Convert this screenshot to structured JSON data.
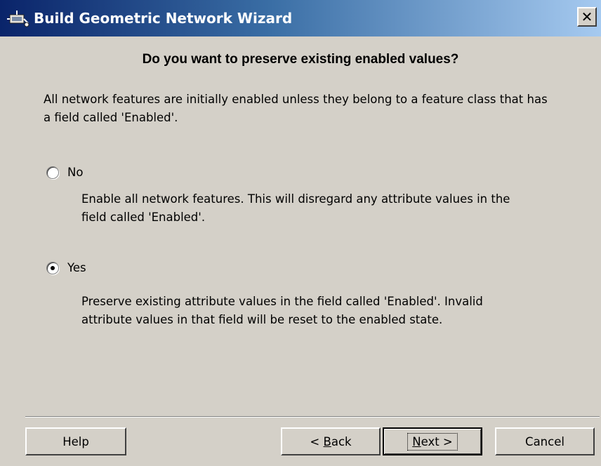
{
  "window": {
    "title": "Build Geometric Network Wizard",
    "close_symbol": "✕"
  },
  "heading": "Do you want to preserve existing enabled values?",
  "description": "All network features are initially enabled unless they belong to a feature class that has a field called 'Enabled'.",
  "options": [
    {
      "label": "No",
      "selected": false,
      "description": "Enable all network features.  This will disregard any attribute values in the field called 'Enabled'."
    },
    {
      "label": "Yes",
      "selected": true,
      "description": "Preserve existing attribute values in the field called 'Enabled'. Invalid attribute values in that field will be reset to the enabled state."
    }
  ],
  "buttons": {
    "help": "Help",
    "back_prefix": "< ",
    "back_accel": "B",
    "back_rest": "ack",
    "next_accel": "N",
    "next_rest": "ext >",
    "cancel": "Cancel"
  },
  "icons": {
    "app": "network-wizard-icon",
    "close": "close-icon"
  }
}
